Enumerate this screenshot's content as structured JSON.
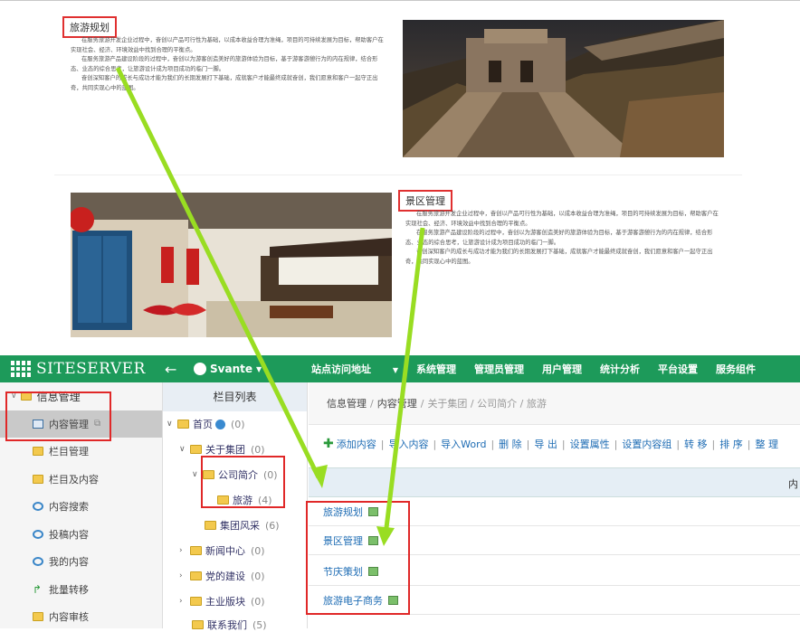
{
  "articles": {
    "travel_planning": {
      "title": "旅游规划",
      "paragraphs": [
        "在服务旅游开发企业过程中，奋创以产品可行性为基础，以成本收益合理为准绳，项目的可持续发展为目标，帮助客户在实现社会、经济、环境效益中找到合理的平衡点。",
        "在服务旅游产品建设阶段的过程中，奋创以为游客创造美好的旅游体验为目标，基于游客游憩行为的内在规律，结合形态、业态的综合思考，让旅游设计成为项目成功的临门一脚。",
        "奋创深知客户的成长与成功才能为我们的长期发展打下基础，成就客户才能最终成就奋创，我们愿意和客户一起守正出奇，共同实现心中的蓝图。"
      ]
    },
    "scenic_management": {
      "title": "景区管理",
      "paragraphs": [
        "在服务旅游开发企业过程中，奋创以产品可行性为基础，以成本收益合理为准绳，项目的可持续发展为目标，帮助客户在实现社会、经济、环境效益中找到合理的平衡点。",
        "在服务旅游产品建设阶段的过程中，奋创以为游客创造美好的旅游体验为目标，基于游客游憩行为的内在规律，结合形态、业态的综合思考，让旅游设计成为项目成功的临门一脚。",
        "奋创深知客户的成长与成功才能为我们的长期发展打下基础，成就客户才能最终成就奋创，我们愿意和客户一起守正出奇，共同实现心中的蓝图。"
      ]
    }
  },
  "header": {
    "logo": "SITESERVER",
    "user": "Svante",
    "nav": [
      "站点访问地址",
      "系统管理",
      "管理员管理",
      "用户管理",
      "统计分析",
      "平台设置",
      "服务组件"
    ]
  },
  "sidebar": {
    "title": "信息管理",
    "items": [
      "内容管理",
      "栏目管理",
      "栏目及内容",
      "内容搜索",
      "投稿内容",
      "我的内容",
      "批量转移",
      "内容审核"
    ]
  },
  "tree": {
    "title": "栏目列表",
    "items": [
      {
        "label": "首页",
        "count": "(0)"
      },
      {
        "label": "关于集团",
        "count": "(0)"
      },
      {
        "label": "公司简介",
        "count": "(0)"
      },
      {
        "label": "旅游",
        "count": "(4)"
      },
      {
        "label": "集团风采",
        "count": "(6)"
      },
      {
        "label": "新闻中心",
        "count": "(0)"
      },
      {
        "label": "党的建设",
        "count": "(0)"
      },
      {
        "label": "主业版块",
        "count": "(0)"
      },
      {
        "label": "联系我们",
        "count": "(5)"
      }
    ]
  },
  "main": {
    "breadcrumb": [
      "信息管理",
      "内容管理",
      "关于集团 / 公司简介 / 旅游"
    ],
    "toolbar": [
      "添加内容",
      "导入内容",
      "导入Word",
      "删 除",
      "导 出",
      "设置属性",
      "设置内容组",
      "转 移",
      "排 序",
      "整 理"
    ],
    "table_header_partial": "内",
    "rows": [
      "旅游规划",
      "景区管理",
      "节庆策划",
      "旅游电子商务"
    ]
  },
  "colors": {
    "header_bg": "#1d9a5a",
    "annotation_red": "#e02828",
    "arrow_green": "#99dd22",
    "link_blue": "#1e6cb4"
  }
}
